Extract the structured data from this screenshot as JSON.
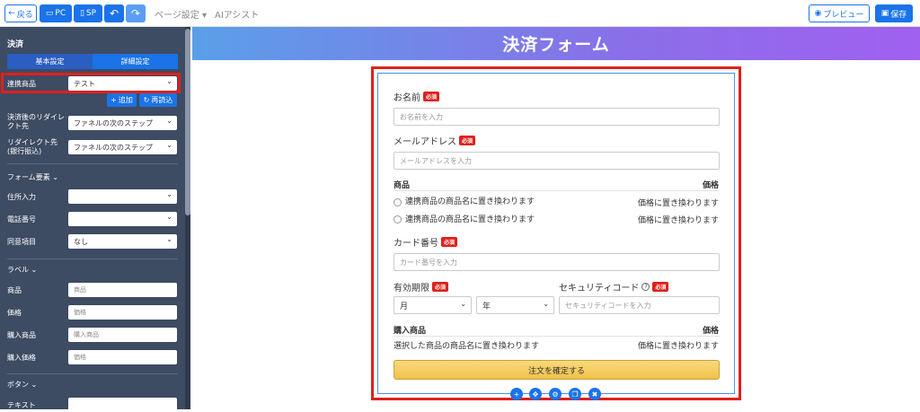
{
  "topbar": {
    "back_label": "戻る",
    "pc_label": "PC",
    "sp_label": "SP",
    "page_settings_label": "ページ設定",
    "ai_assist_label": "AIアシスト",
    "preview_label": "プレビュー",
    "save_label": "保存"
  },
  "sidebar": {
    "section_title": "決済",
    "tabs": [
      {
        "label": "基本設定"
      },
      {
        "label": "詳細設定"
      }
    ],
    "linked_product": {
      "label": "連携商品",
      "value": "テスト"
    },
    "add_button": "追加",
    "reload_button": "再読込",
    "redirect_after_payment": {
      "label": "決済後のリダイレクト先",
      "value": "ファネルの次のステップ"
    },
    "redirect_bank": {
      "label": "リダイレクト先(銀行振込)",
      "value": "ファネルの次のステップ"
    },
    "form_elements": {
      "title": "フォーム要素"
    },
    "address_input": {
      "label": "住所入力",
      "value": ""
    },
    "phone_number": {
      "label": "電話番号",
      "value": ""
    },
    "consent_item": {
      "label": "同意項目",
      "value": "なし"
    },
    "labels": {
      "title": "ラベル"
    },
    "label_product": {
      "label": "商品",
      "value": "商品"
    },
    "label_price": {
      "label": "価格",
      "value": "価格"
    },
    "label_purchase_product": {
      "label": "購入商品",
      "value": "購入商品"
    },
    "label_purchase_price": {
      "label": "購入価格",
      "value": "価格"
    },
    "button_section": {
      "title": "ボタン"
    },
    "text_field": {
      "label": "テキスト",
      "value": ""
    }
  },
  "banner": {
    "title": "決済フォーム"
  },
  "form": {
    "name": {
      "label": "お名前",
      "required": "必須",
      "placeholder": "お名前を入力"
    },
    "email": {
      "label": "メールアドレス",
      "required": "必須",
      "placeholder": "メールアドレスを入力"
    },
    "products_header": {
      "product": "商品",
      "price": "価格"
    },
    "products": [
      {
        "name": "連携商品の商品名に置き換わります",
        "price": "価格に置き換わります"
      },
      {
        "name": "連携商品の商品名に置き換わります",
        "price": "価格に置き換わります"
      }
    ],
    "card": {
      "label": "カード番号",
      "required": "必須",
      "placeholder": "カード番号を入力"
    },
    "expiry": {
      "label": "有効期限",
      "required": "必須",
      "month": "月",
      "year": "年"
    },
    "security": {
      "label": "セキュリティコード",
      "help": "?",
      "required": "必須",
      "placeholder": "セキュリティコードを入力"
    },
    "purchase_header": {
      "product": "購入商品",
      "price": "価格"
    },
    "purchase_row": {
      "name": "選択した商品の商品名に置き換わります",
      "price": "価格に置き換わります"
    },
    "submit_label": "注文を確定する"
  },
  "colors": {
    "accent": "#1a73e8",
    "highlight": "#e0201b",
    "sidebar_bg": "#3d4b63",
    "submit": "#f0c14b"
  }
}
